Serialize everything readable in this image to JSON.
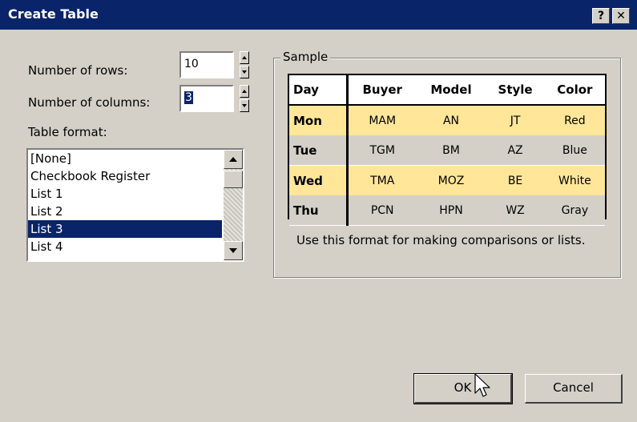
{
  "window": {
    "title": "Create Table",
    "help_label": "?",
    "close_label": "✕"
  },
  "rows": {
    "label": "Number of rows:",
    "value": "10"
  },
  "columns": {
    "label": "Number of columns:",
    "value": "3"
  },
  "table_format": {
    "label": "Table format:",
    "items": [
      "[None]",
      "Checkbook Register",
      "List 1",
      "List 2",
      "List 3",
      "List 4"
    ],
    "selected": "List 3"
  },
  "sample": {
    "legend": "Sample",
    "headers": [
      "Day",
      "Buyer",
      "Model",
      "Style",
      "Color"
    ],
    "rows": [
      [
        "Mon",
        "MAM",
        "AN",
        "JT",
        "Red"
      ],
      [
        "Tue",
        "TGM",
        "BM",
        "AZ",
        "Blue"
      ],
      [
        "Wed",
        "TMA",
        "MOZ",
        "BE",
        "White"
      ],
      [
        "Thu",
        "PCN",
        "HPN",
        "WZ",
        "Gray"
      ]
    ],
    "caption": "Use this format for making comparisons or lists."
  },
  "buttons": {
    "ok": "OK",
    "cancel": "Cancel"
  },
  "colors": {
    "titlebar": "#0a246a",
    "highlight_row": "#ffe699",
    "face": "#d4d0c8"
  }
}
